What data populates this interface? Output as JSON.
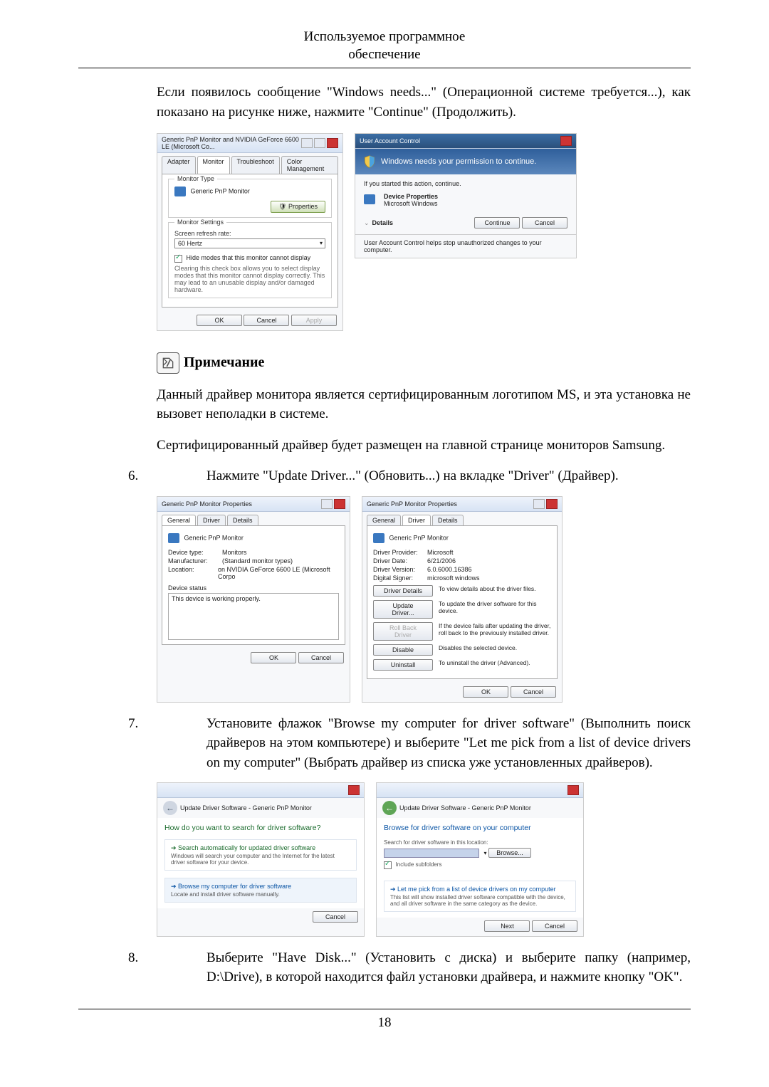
{
  "header": {
    "line1": "Используемое программное",
    "line2": "обеспечение"
  },
  "para1": "Если появилось сообщение \"Windows needs...\" (Операционной системе требуется...), как показано на рисунке ниже, нажмите \"Continue\" (Продолжить).",
  "shot_monitor": {
    "title": "Generic PnP Monitor and NVIDIA GeForce 6600 LE (Microsoft Co...",
    "tabs": [
      "Adapter",
      "Monitor",
      "Troubleshoot",
      "Color Management"
    ],
    "group1": "Monitor Type",
    "monitor_name": "Generic PnP Monitor",
    "properties_btn": "Properties",
    "group2": "Monitor Settings",
    "refresh_label": "Screen refresh rate:",
    "refresh_value": "60 Hertz",
    "hide_modes": "Hide modes that this monitor cannot display",
    "hide_desc": "Clearing this check box allows you to select display modes that this monitor cannot display correctly. This may lead to an unusable display and/or damaged hardware.",
    "ok": "OK",
    "cancel": "Cancel",
    "apply": "Apply"
  },
  "shot_uac": {
    "title": "User Account Control",
    "headline": "Windows needs your permission to continue.",
    "started": "If you started this action, continue.",
    "dev_props": "Device Properties",
    "ms_windows": "Microsoft Windows",
    "details": "Details",
    "continue": "Continue",
    "cancel": "Cancel",
    "helpline": "User Account Control helps stop unauthorized changes to your computer."
  },
  "note": {
    "label": "Примечание",
    "p1": "Данный драйвер монитора является сертифицированным логотипом MS, и эта установка не вызовет неполадки в системе.",
    "p2": "Сертифицированный драйвер будет размещен на главной странице мониторов Samsung."
  },
  "step6": {
    "num": "6.",
    "text": "Нажмите \"Update Driver...\" (Обновить...) на вкладке \"Driver\" (Драйвер)."
  },
  "shot_props_general": {
    "title": "Generic PnP Monitor Properties",
    "tabs": [
      "General",
      "Driver",
      "Details"
    ],
    "name": "Generic PnP Monitor",
    "devtype_l": "Device type:",
    "devtype_v": "Monitors",
    "manu_l": "Manufacturer:",
    "manu_v": "(Standard monitor types)",
    "loc_l": "Location:",
    "loc_v": "on NVIDIA GeForce 6600 LE (Microsoft Corpo",
    "status_l": "Device status",
    "status_v": "This device is working properly.",
    "ok": "OK",
    "cancel": "Cancel"
  },
  "shot_props_driver": {
    "title": "Generic PnP Monitor Properties",
    "tabs": [
      "General",
      "Driver",
      "Details"
    ],
    "name": "Generic PnP Monitor",
    "provider_l": "Driver Provider:",
    "provider_v": "Microsoft",
    "date_l": "Driver Date:",
    "date_v": "6/21/2006",
    "version_l": "Driver Version:",
    "version_v": "6.0.6000.16386",
    "signer_l": "Digital Signer:",
    "signer_v": "microsoft windows",
    "details_btn": "Driver Details",
    "details_txt": "To view details about the driver files.",
    "update_btn": "Update Driver...",
    "update_txt": "To update the driver software for this device.",
    "rollback_btn": "Roll Back Driver",
    "rollback_txt": "If the device fails after updating the driver, roll back to the previously installed driver.",
    "disable_btn": "Disable",
    "disable_txt": "Disables the selected device.",
    "uninstall_btn": "Uninstall",
    "uninstall_txt": "To uninstall the driver (Advanced).",
    "ok": "OK",
    "cancel": "Cancel"
  },
  "step7": {
    "num": "7.",
    "text": "Установите флажок \"Browse my computer for driver software\" (Выполнить поиск драйверов на этом компьютере) и выберите \"Let me pick from a list of device drivers on my computer\" (Выбрать драйвер из списка уже установленных драйверов)."
  },
  "shot_wizard1": {
    "breadcrumb": "Update Driver Software - Generic PnP Monitor",
    "heading": "How do you want to search for driver software?",
    "opt1": "Search automatically for updated driver software",
    "opt1_sub": "Windows will search your computer and the Internet for the latest driver software for your device.",
    "opt2": "Browse my computer for driver software",
    "opt2_sub": "Locate and install driver software manually.",
    "cancel": "Cancel"
  },
  "shot_wizard2": {
    "breadcrumb": "Update Driver Software - Generic PnP Monitor",
    "heading": "Browse for driver software on your computer",
    "search_label": "Search for driver software in this location:",
    "browse": "Browse...",
    "include": "Include subfolders",
    "opt": "Let me pick from a list of device drivers on my computer",
    "opt_sub": "This list will show installed driver software compatible with the device, and all driver software in the same category as the device.",
    "next": "Next",
    "cancel": "Cancel"
  },
  "step8": {
    "num": "8.",
    "text": "Выберите \"Have Disk...\" (Установить с диска) и выберите папку (например, D:\\Drive), в которой находится файл установки драйвера, и нажмите кнопку \"OK\"."
  },
  "page_number": "18"
}
